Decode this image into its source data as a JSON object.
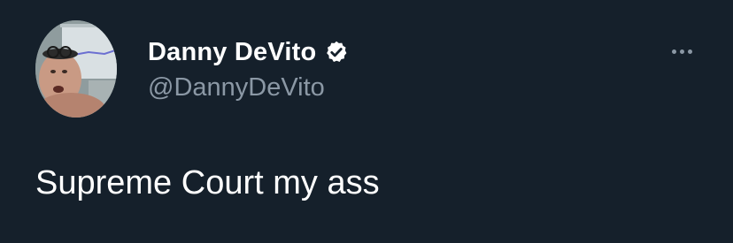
{
  "tweet": {
    "author": {
      "display_name": "Danny DeVito",
      "handle": "@DannyDeVito",
      "verified": true,
      "verified_icon": "verified-badge-icon",
      "avatar_icon": "profile-avatar"
    },
    "text": "Supreme Court my ass",
    "more_icon": "more-options-icon"
  },
  "colors": {
    "background": "#15202b",
    "primary_text": "#ffffff",
    "secondary_text": "#8b98a5"
  }
}
